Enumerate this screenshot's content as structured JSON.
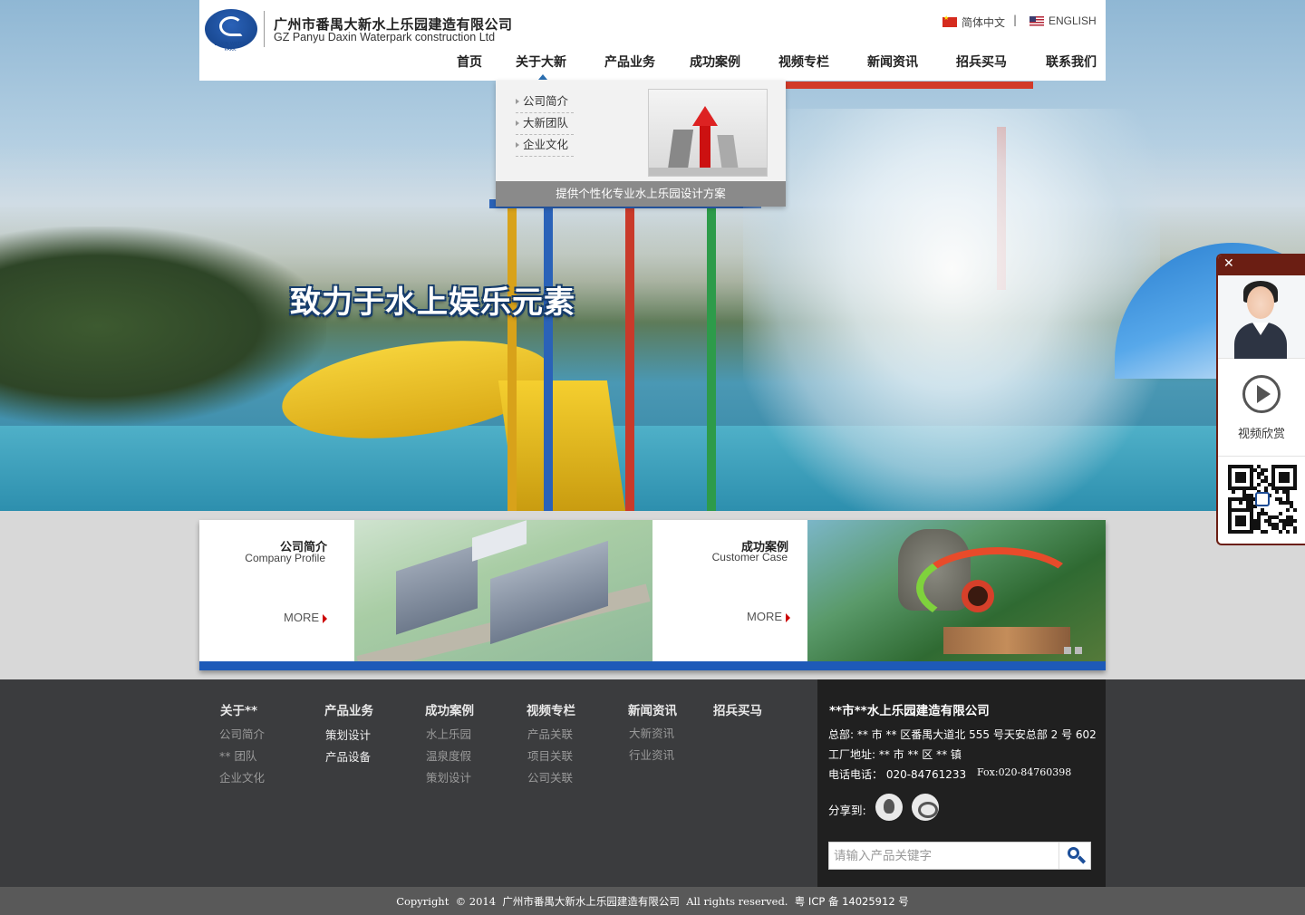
{
  "header": {
    "logo_subtext": "DAXIN WATER PARK",
    "company_cn": "广州市番禺大新水上乐园建造有限公司",
    "company_en": "GZ Panyu Daxin Waterpark construction Ltd",
    "lang_cn": "简体中文",
    "lang_sep": "|",
    "lang_en": "ENGLISH"
  },
  "nav": {
    "items": [
      {
        "label": "首页"
      },
      {
        "label": "关于大新"
      },
      {
        "label": "产品业务"
      },
      {
        "label": "成功案例"
      },
      {
        "label": "视频专栏"
      },
      {
        "label": "新闻资讯"
      },
      {
        "label": "招兵买马"
      },
      {
        "label": "联系我们"
      }
    ],
    "active": "关于大新"
  },
  "dropdown": {
    "items": [
      {
        "label": "公司简介"
      },
      {
        "label": "大新团队"
      },
      {
        "label": "企业文化"
      }
    ],
    "caption": "提供个性化专业水上乐园设计方案"
  },
  "hero": {
    "slogan": "致力于水上娱乐元素"
  },
  "side_widget": {
    "close": "✕",
    "video_label": "视频欣赏"
  },
  "features": [
    {
      "title": "公司简介",
      "subtitle": "Company Profile",
      "more": "MORE"
    },
    {
      "title": "成功案例",
      "subtitle": "Customer Case",
      "more": "MORE"
    }
  ],
  "footer": {
    "columns": [
      {
        "title": "关于**",
        "links": [
          "公司简介",
          "** 团队",
          "企业文化"
        ]
      },
      {
        "title": "产品业务",
        "links": [
          "策划设计",
          "产品设备"
        ]
      },
      {
        "title": "成功案例",
        "links": [
          "水上乐园",
          "温泉度假",
          "策划设计"
        ]
      },
      {
        "title": "视频专栏",
        "links": [
          "产品关联",
          "项目关联",
          "公司关联"
        ]
      },
      {
        "title": "新闻资讯",
        "links": [
          "大新资讯",
          "行业资讯"
        ]
      },
      {
        "title": "招兵买马",
        "links": []
      }
    ],
    "contact": {
      "title": "**市**水上乐园建造有限公司",
      "hq": "总部: ** 市 ** 区番禺大道北 555 号天安总部 2 号 602",
      "factory": "工厂地址: ** 市 ** 区 ** 镇",
      "phone": "电话电话： 020-84761233",
      "fax": "Fox:020-84760398",
      "share_label": "分享到:"
    },
    "search": {
      "placeholder": "请输入产品关键字"
    }
  },
  "copyright": {
    "prefix": "Copyright  © 2014  ",
    "company": "广州市番禺大新水上乐园建造有限公司",
    "rights": "  All rights reserved.  ",
    "icp": "粤 ICP 备 14025912 号"
  }
}
